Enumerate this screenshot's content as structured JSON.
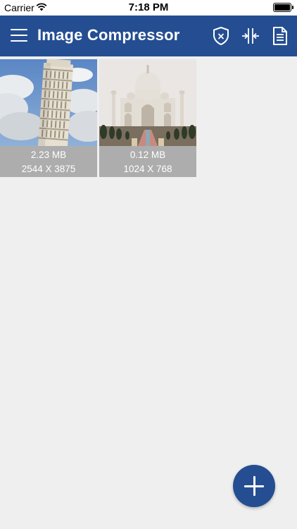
{
  "status_bar": {
    "carrier": "Carrier",
    "time": "7:18 PM"
  },
  "navbar": {
    "title": "Image Compressor",
    "icons": [
      "menu-icon",
      "shield-x-icon",
      "compress-icon",
      "document-icon"
    ]
  },
  "images": [
    {
      "size": "2.23 MB",
      "dimensions": "2544 X 3875",
      "subject": "leaning-tower-of-pisa"
    },
    {
      "size": "0.12 MB",
      "dimensions": "1024 X 768",
      "subject": "taj-mahal"
    }
  ],
  "fab": {
    "icon": "plus-icon"
  },
  "colors": {
    "primary": "#244e91",
    "background": "#efefef",
    "caption": "#adadad"
  }
}
